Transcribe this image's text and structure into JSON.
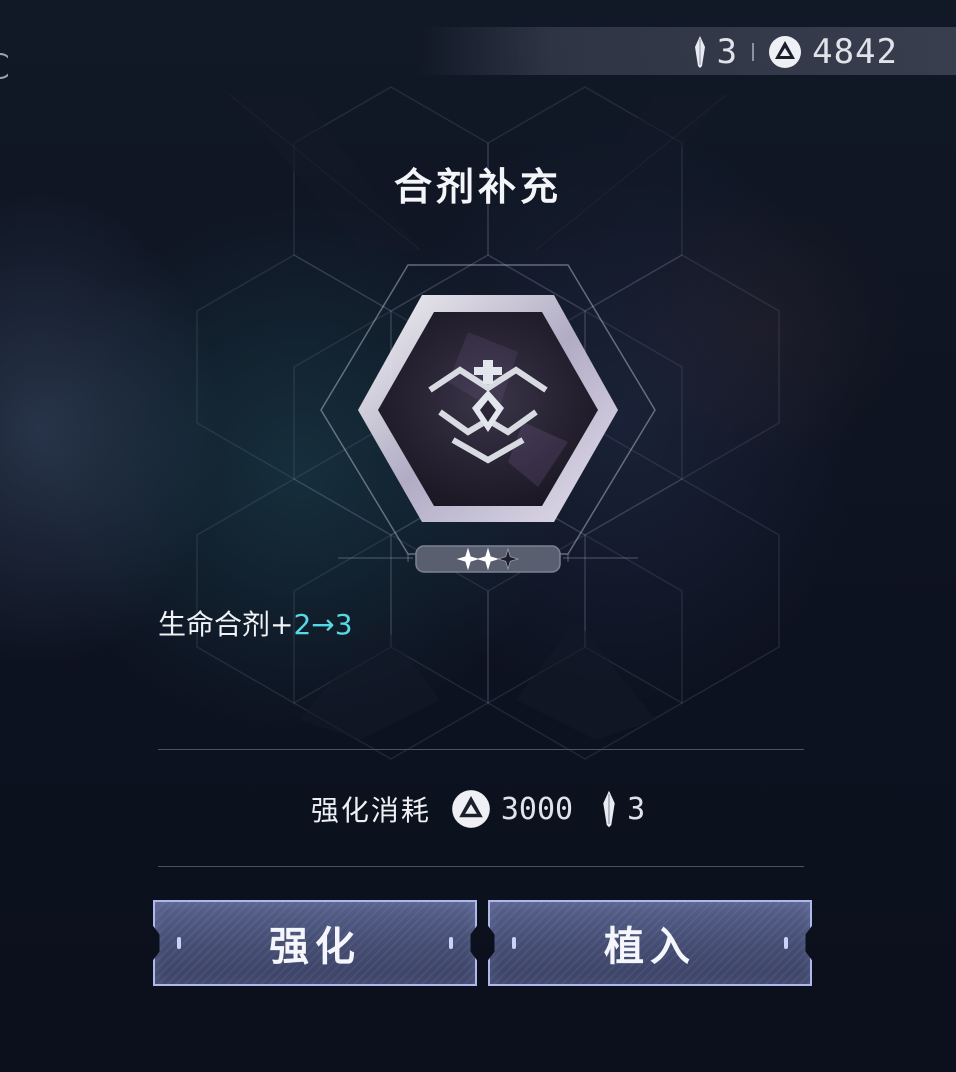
{
  "header": {
    "gem_count": "3",
    "coin_count": "4842"
  },
  "title": "合剂补充",
  "item": {
    "stars_filled": 2,
    "stars_total": 3
  },
  "effect": {
    "label": "生命合剂+",
    "change": "2→3"
  },
  "cost": {
    "label": "强化消耗",
    "coin_amount": "3000",
    "gem_amount": "3"
  },
  "buttons": {
    "enhance": "强化",
    "implant": "植入"
  },
  "colors": {
    "accent_cyan": "#57d8e8",
    "button_border": "#aeb8ea",
    "button_fill": "#48507a"
  }
}
